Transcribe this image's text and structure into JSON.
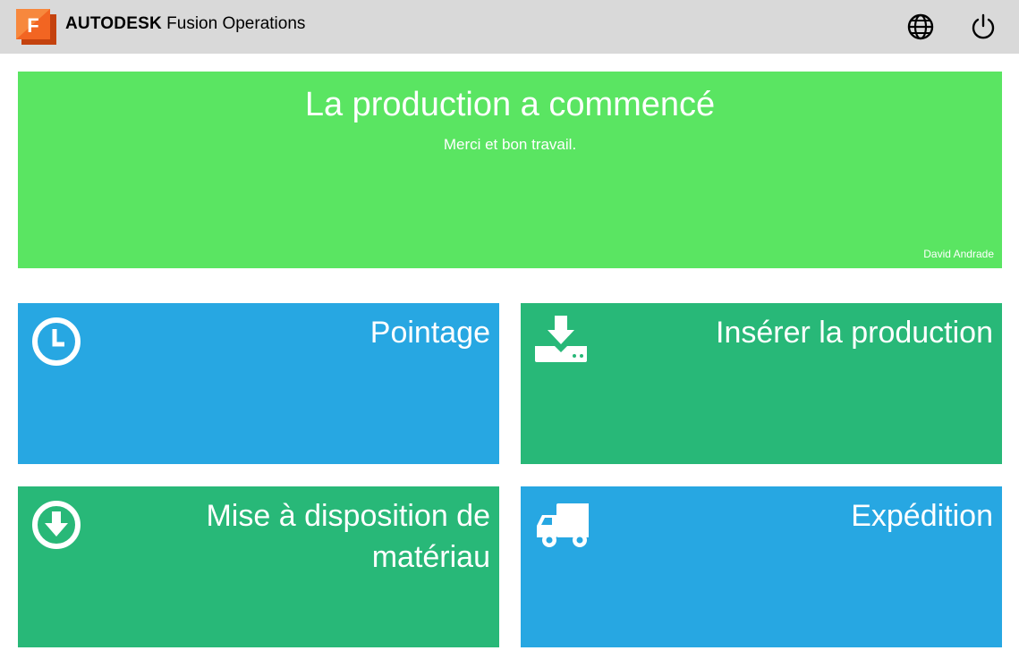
{
  "header": {
    "logo_letter": "F",
    "brand_bold": "AUTODESK",
    "brand_product": "Fusion Operations",
    "icons": [
      "globe-icon",
      "power-icon"
    ]
  },
  "banner": {
    "title": "La production a commencé",
    "subtitle": "Merci et bon travail.",
    "user": "David Andrade",
    "color": "#5ae562"
  },
  "tiles": [
    {
      "label": "Pointage",
      "icon": "clock-icon",
      "color": "#27a7e2"
    },
    {
      "label": "Insérer la production",
      "icon": "download-tray-icon",
      "color": "#28b878"
    },
    {
      "label": "Mise à disposition de matériau",
      "icon": "arrow-down-circle-icon",
      "color": "#28b878"
    },
    {
      "label": "Expédition",
      "icon": "truck-icon",
      "color": "#27a7e2"
    }
  ]
}
